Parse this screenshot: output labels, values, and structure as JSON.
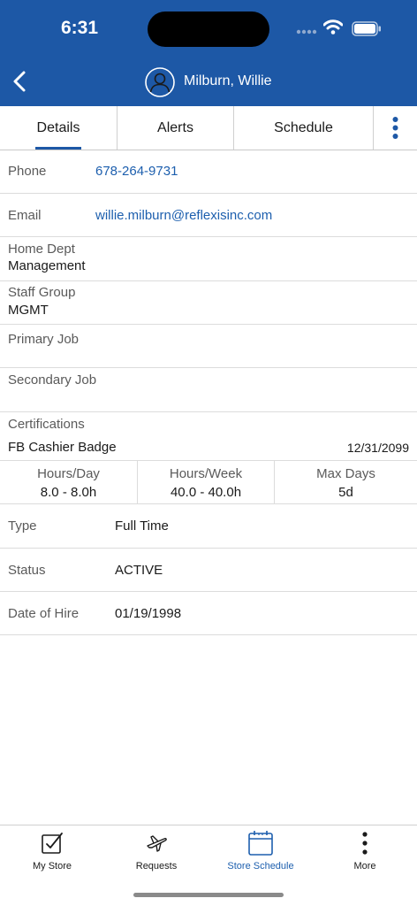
{
  "status_bar": {
    "time": "6:31"
  },
  "header": {
    "title": "Milburn, Willie"
  },
  "tabs": [
    {
      "label": "Details"
    },
    {
      "label": "Alerts"
    },
    {
      "label": "Schedule"
    }
  ],
  "details": {
    "phone": {
      "label": "Phone",
      "value": "678-264-9731"
    },
    "email": {
      "label": "Email",
      "value": "willie.milburn@reflexisinc.com"
    },
    "home_dept": {
      "label": "Home Dept",
      "value": "Management"
    },
    "staff_group": {
      "label": "Staff Group",
      "value": "MGMT"
    },
    "primary_job": {
      "label": "Primary Job",
      "value": ""
    },
    "secondary_job": {
      "label": "Secondary Job",
      "value": ""
    },
    "certifications": {
      "label": "Certifications",
      "name": "FB Cashier Badge",
      "date": "12/31/2099"
    }
  },
  "hours": [
    {
      "label": "Hours/Day",
      "value": "8.0 - 8.0h"
    },
    {
      "label": "Hours/Week",
      "value": "40.0 - 40.0h"
    },
    {
      "label": "Max Days",
      "value": "5d"
    }
  ],
  "info": {
    "type": {
      "label": "Type",
      "value": "Full Time"
    },
    "status": {
      "label": "Status",
      "value": "ACTIVE"
    },
    "hire": {
      "label": "Date of Hire",
      "value": "01/19/1998"
    }
  },
  "bottom_nav": [
    {
      "label": "My Store",
      "icon": "checkbox-icon"
    },
    {
      "label": "Requests",
      "icon": "airplane-icon"
    },
    {
      "label": "Store Schedule",
      "icon": "calendar-icon",
      "active": true
    },
    {
      "label": "More",
      "icon": "vertical-dots-icon"
    }
  ],
  "colors": {
    "brand": "#1d58a6",
    "link": "#1d5fae"
  }
}
